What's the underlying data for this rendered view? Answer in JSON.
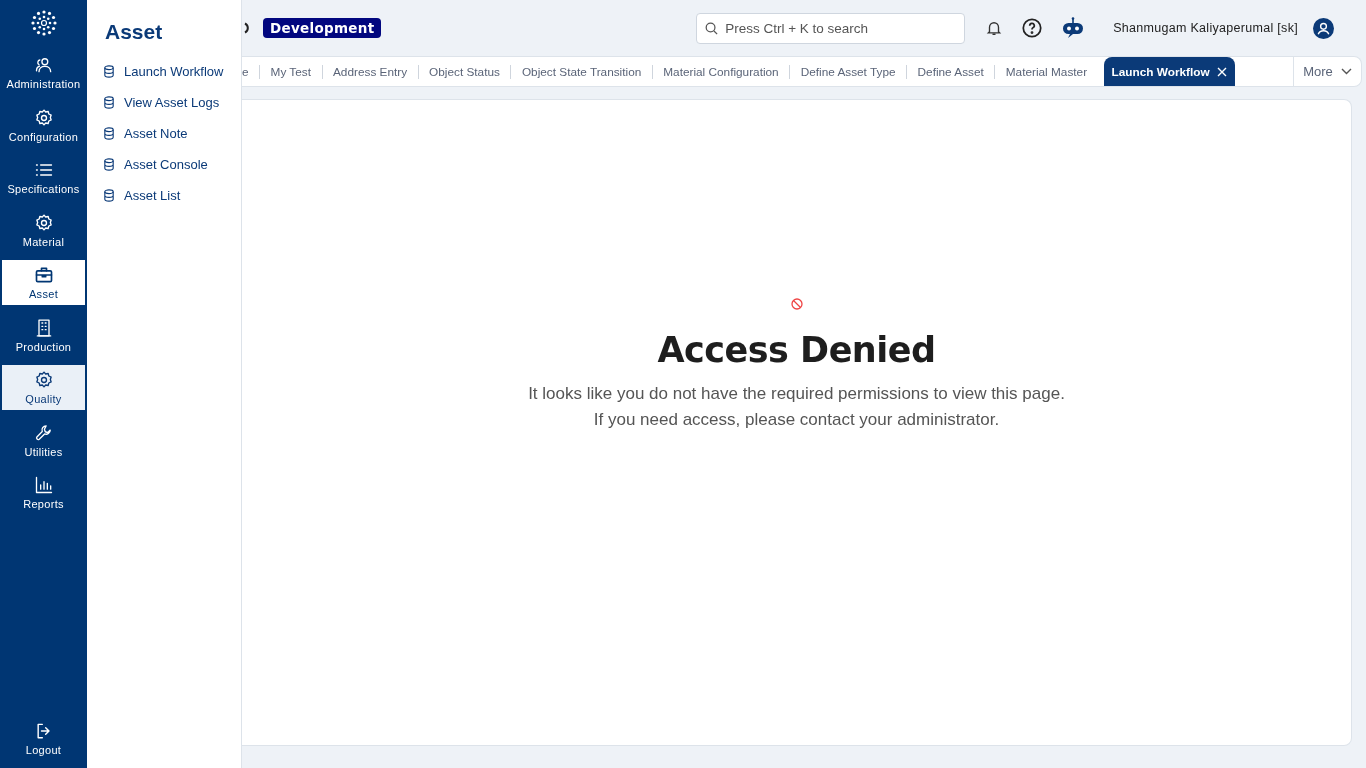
{
  "nav": [
    {
      "label": "Administration",
      "kind": "users",
      "selected": false,
      "hovered": false
    },
    {
      "label": "Configuration",
      "kind": "gear",
      "selected": false,
      "hovered": false
    },
    {
      "label": "Specifications",
      "kind": "list",
      "selected": false,
      "hovered": false
    },
    {
      "label": "Material",
      "kind": "gear",
      "selected": false,
      "hovered": false
    },
    {
      "label": "Asset",
      "kind": "briefcase",
      "selected": true,
      "hovered": false
    },
    {
      "label": "Production",
      "kind": "building",
      "selected": false,
      "hovered": false
    },
    {
      "label": "Quality",
      "kind": "gear",
      "selected": false,
      "hovered": true
    },
    {
      "label": "Utilities",
      "kind": "wrench",
      "selected": false,
      "hovered": false
    },
    {
      "label": "Reports",
      "kind": "chart",
      "selected": false,
      "hovered": false
    }
  ],
  "logout": {
    "label": "Logout"
  },
  "flyout": {
    "title": "Asset",
    "items": [
      {
        "label": "Launch Workflow"
      },
      {
        "label": "View Asset Logs"
      },
      {
        "label": "Asset Note"
      },
      {
        "label": "Asset Console"
      },
      {
        "label": "Asset List"
      }
    ]
  },
  "header": {
    "environment": "Development",
    "search": {
      "placeholder": "Press Ctrl + K to search"
    },
    "user": "Shanmugam Kaliyaperumal [sk]"
  },
  "tabs": [
    {
      "label": "e",
      "selected": false
    },
    {
      "label": "My Test",
      "selected": false
    },
    {
      "label": "Address Entry",
      "selected": false
    },
    {
      "label": "Object Status",
      "selected": false
    },
    {
      "label": "Object State Transition",
      "selected": false
    },
    {
      "label": "Material Configuration",
      "selected": false
    },
    {
      "label": "Define Asset Type",
      "selected": false
    },
    {
      "label": "Define Asset",
      "selected": false
    },
    {
      "label": "Material Master",
      "selected": false
    },
    {
      "label": "Launch Workflow",
      "selected": true
    }
  ],
  "more": {
    "label": "More"
  },
  "message": {
    "title": "Access Denied",
    "lines": [
      "It looks like you do not have the required permissions to view this page.",
      "If you need access, please contact your administrator."
    ]
  }
}
